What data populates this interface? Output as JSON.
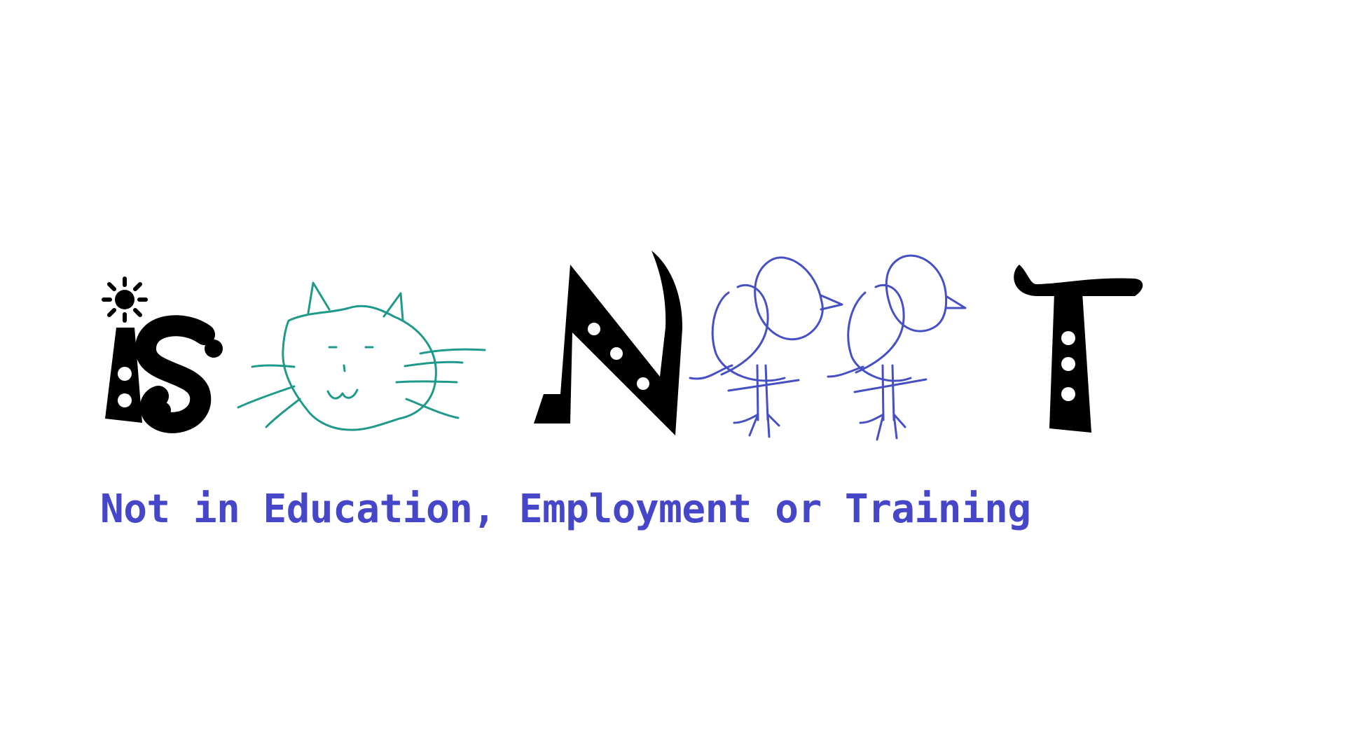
{
  "logo": {
    "wordmark": "isNEET",
    "ink_color": "#000000",
    "cat_color": "#1f9a8a",
    "bird_color": "#4650c4"
  },
  "subtitle": {
    "text": "Not in Education, Employment or Training",
    "color": "#4646c8"
  }
}
